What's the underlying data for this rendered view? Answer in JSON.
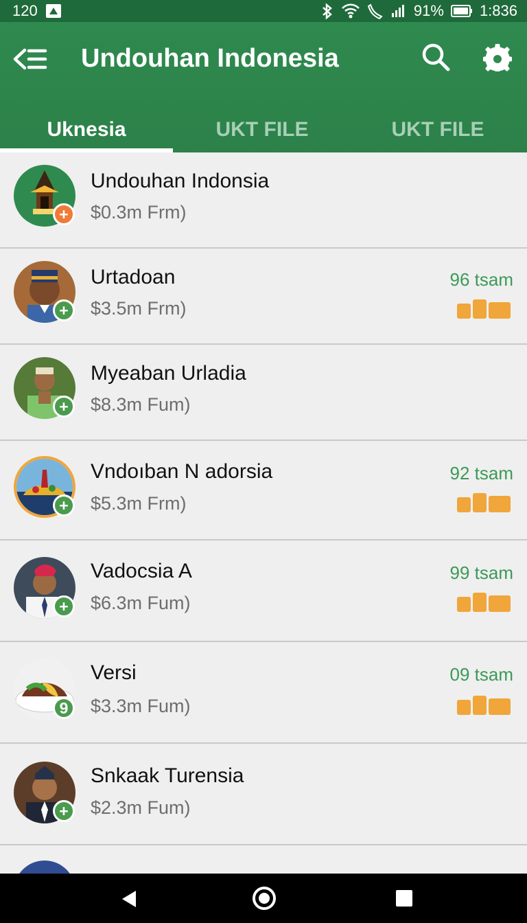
{
  "status": {
    "time_left": "120",
    "battery": "91%",
    "clock": "1:836"
  },
  "app": {
    "title": "Undouhan Indonesia"
  },
  "tabs": [
    {
      "label": "Uknesia",
      "active": true
    },
    {
      "label": "UKT FILE",
      "active": false
    },
    {
      "label": "UKT FILE",
      "active": false
    }
  ],
  "items": [
    {
      "name": "Undouhan Indonsia",
      "subtitle": "$0.3m Frm)",
      "time": "",
      "plus_label": "+"
    },
    {
      "name": "Urtadoan",
      "subtitle": "$3.5m Frm)",
      "time": "96 tsam",
      "plus_label": "+"
    },
    {
      "name": "Myeaban Urladia",
      "subtitle": "$8.3m Fum)",
      "time": "",
      "plus_label": "+"
    },
    {
      "name": "Vndoıban N adorsia",
      "subtitle": "$5.3m Frm)",
      "time": "92 tsam",
      "plus_label": "+"
    },
    {
      "name": "Vadocsia A",
      "subtitle": "$6.3m Fum)",
      "time": "99 tsam",
      "plus_label": "+"
    },
    {
      "name": "Versi",
      "subtitle": "$3.3m Fum)",
      "time": "09 tsam",
      "plus_label": "9"
    },
    {
      "name": "Snkaak Turensia",
      "subtitle": "$2.3m Fum)",
      "time": "",
      "plus_label": "+"
    }
  ],
  "colors": {
    "app_green": "#2f8a4f",
    "accent_green": "#3c9a57",
    "orange": "#f0a63a"
  }
}
